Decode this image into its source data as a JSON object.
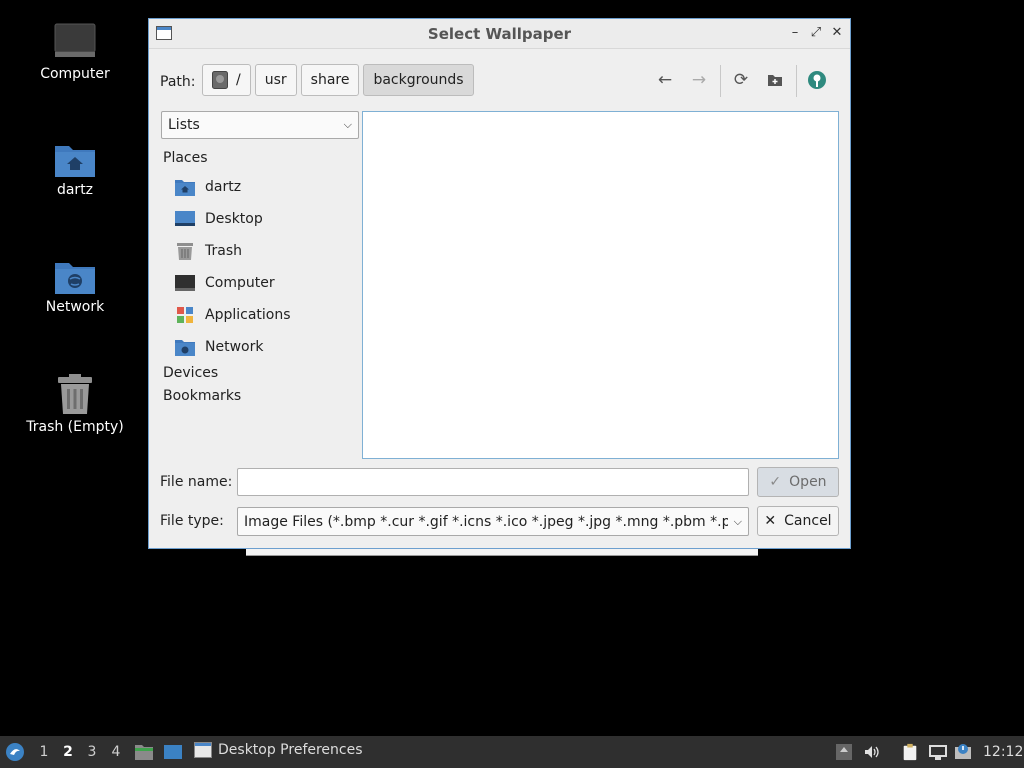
{
  "desktop": {
    "icons": [
      {
        "label": "Computer",
        "icon": "monitor-icon"
      },
      {
        "label": "dartz",
        "icon": "home-folder-icon"
      },
      {
        "label": "Network",
        "icon": "network-folder-icon"
      },
      {
        "label": "Trash (Empty)",
        "icon": "trash-icon"
      }
    ]
  },
  "dialog": {
    "title": "Select Wallpaper",
    "path_label": "Path:",
    "path_segments": [
      "/",
      "usr",
      "share",
      "backgrounds"
    ],
    "view_mode": "Lists",
    "places_heading": "Places",
    "places": [
      {
        "label": "dartz",
        "icon": "home-folder-icon"
      },
      {
        "label": "Desktop",
        "icon": "desktop-icon"
      },
      {
        "label": "Trash",
        "icon": "trash-icon"
      },
      {
        "label": "Computer",
        "icon": "monitor-icon"
      },
      {
        "label": "Applications",
        "icon": "applications-icon"
      },
      {
        "label": "Network",
        "icon": "network-folder-icon"
      }
    ],
    "devices_heading": "Devices",
    "bookmarks_heading": "Bookmarks",
    "file_name_label": "File name:",
    "file_name_value": "",
    "file_type_label": "File type:",
    "file_type_value": "Image Files (*.bmp *.cur *.gif *.icns *.ico *.jpeg *.jpg *.mng *.pbm *.pgm",
    "open_label": "Open",
    "cancel_label": "Cancel"
  },
  "taskbar": {
    "workspaces": [
      "1",
      "2",
      "3",
      "4"
    ],
    "active_workspace": "2",
    "window_title": "Desktop Preferences",
    "clock": "12:12"
  },
  "colors": {
    "accent": "#6d9fcf",
    "folder_blue": "#4a86c8",
    "taskbar_bg": "#2f2f2f"
  }
}
